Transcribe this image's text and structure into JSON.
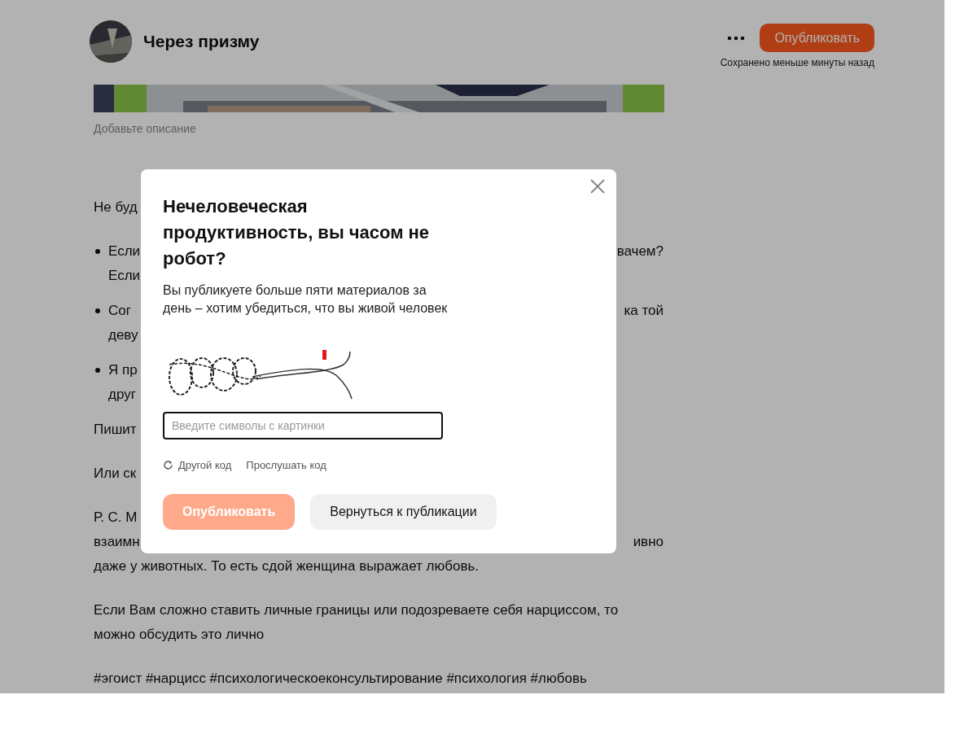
{
  "header": {
    "title": "Через призму",
    "publish_button": "Опубликовать",
    "saved_status": "Сохранено меньше минуты назад"
  },
  "cover": {
    "caption_placeholder": "Добавьте описание"
  },
  "article": [
    {
      "kind": "text",
      "lines": [
        {
          "left": "Не буд"
        }
      ]
    },
    {
      "kind": "bullet",
      "lines": [
        {
          "left": "Если",
          "right": "вачем?"
        },
        {
          "left": "Если"
        }
      ]
    },
    {
      "kind": "bullet",
      "lines": [
        {
          "left": " Сог",
          "right": "ка той"
        },
        {
          "left": "деву"
        }
      ]
    },
    {
      "kind": "bullet",
      "lines": [
        {
          "left": " Я пр"
        },
        {
          "left": "друг"
        }
      ]
    },
    {
      "kind": "text",
      "lines": [
        {
          "left": "Пишит"
        }
      ]
    },
    {
      "kind": "text",
      "lines": [
        {
          "left": "Или ск"
        }
      ]
    },
    {
      "kind": "text",
      "lines": [
        {
          "left": "Р. С. М"
        },
        {
          "left": "взаимн",
          "right": "ивно"
        },
        {
          "left": "даже у животных. То есть сдой женщина выражает любовь."
        }
      ]
    },
    {
      "kind": "text",
      "lines": [
        {
          "left": "Если Вам сложно ставить личные границы или подозреваете себя нарциссом, то"
        },
        {
          "left": "можно обсудить это лично"
        }
      ]
    },
    {
      "kind": "text",
      "lines": [
        {
          "left": "#эгоист #нарцисс #психологическоеконсультирование #психология #любовь"
        }
      ]
    }
  ],
  "modal": {
    "title": "Нечеловеческая продуктивность, вы часом не робот?",
    "text": "Вы публикуете больше пяти материалов за день – хотим убедиться, что вы живой человек",
    "captcha_input": {
      "placeholder": "Введите символы с картинки"
    },
    "links": [
      {
        "label": "Другой код",
        "kind": "refresh"
      },
      {
        "label": "Прослушать код",
        "kind": "plain"
      }
    ],
    "buttons": [
      {
        "label": "Опубликовать",
        "kind": "primary",
        "disabled": true
      },
      {
        "label": "Вернуться к публикации",
        "kind": "secondary",
        "disabled": false
      }
    ]
  }
}
